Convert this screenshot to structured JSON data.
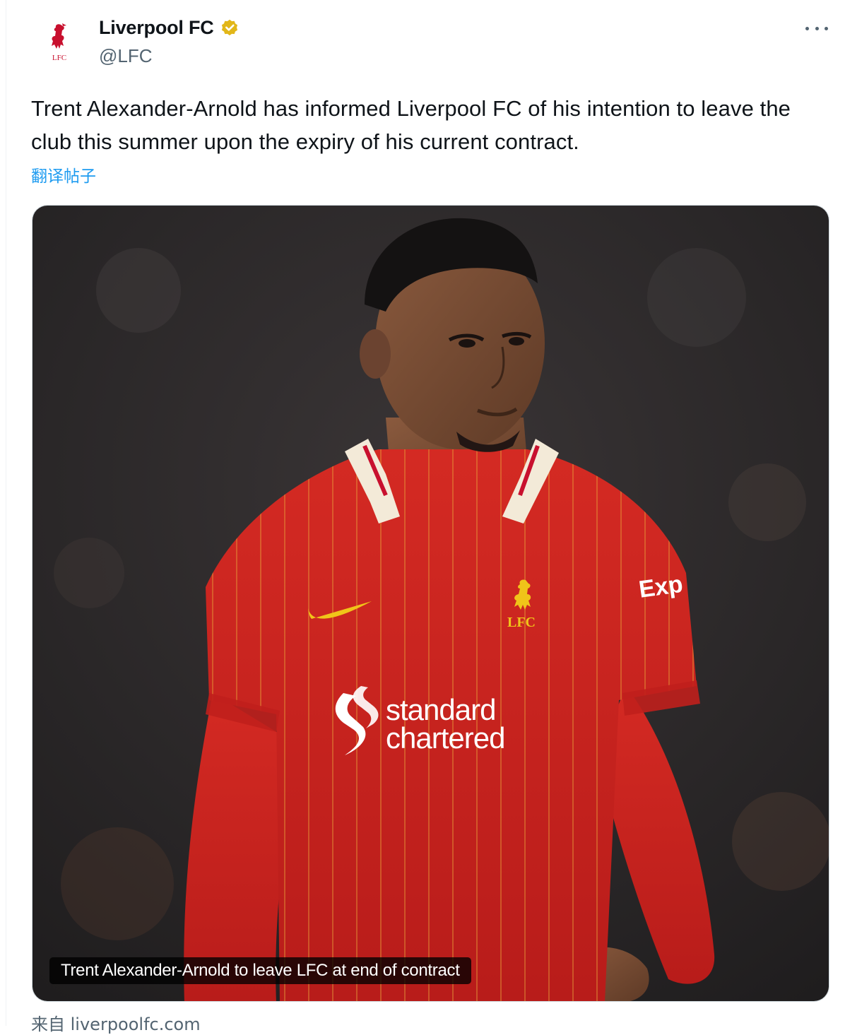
{
  "account": {
    "display_name": "Liverpool FC",
    "handle": "@LFC",
    "verified": true,
    "verified_color": "#e2b719"
  },
  "tweet": {
    "text": "Trent Alexander-Arnold has informed Liverpool FC of his intention to leave the club this summer upon the expiry of his current contract.",
    "translate_label": "翻译帖子"
  },
  "card": {
    "caption": "Trent Alexander-Arnold to leave LFC at end of contract",
    "source_prefix": "来自",
    "source_domain": "liverpoolfc.com"
  },
  "icons": {
    "avatar": "liverbird-crest-icon",
    "verified": "verified-badge-icon",
    "more": "more-options-icon"
  },
  "colors": {
    "lfc_red": "#c8102e",
    "link_blue": "#1d9bf0",
    "shirt_red": "#c5201f",
    "sponsor_white": "#ffffff"
  }
}
